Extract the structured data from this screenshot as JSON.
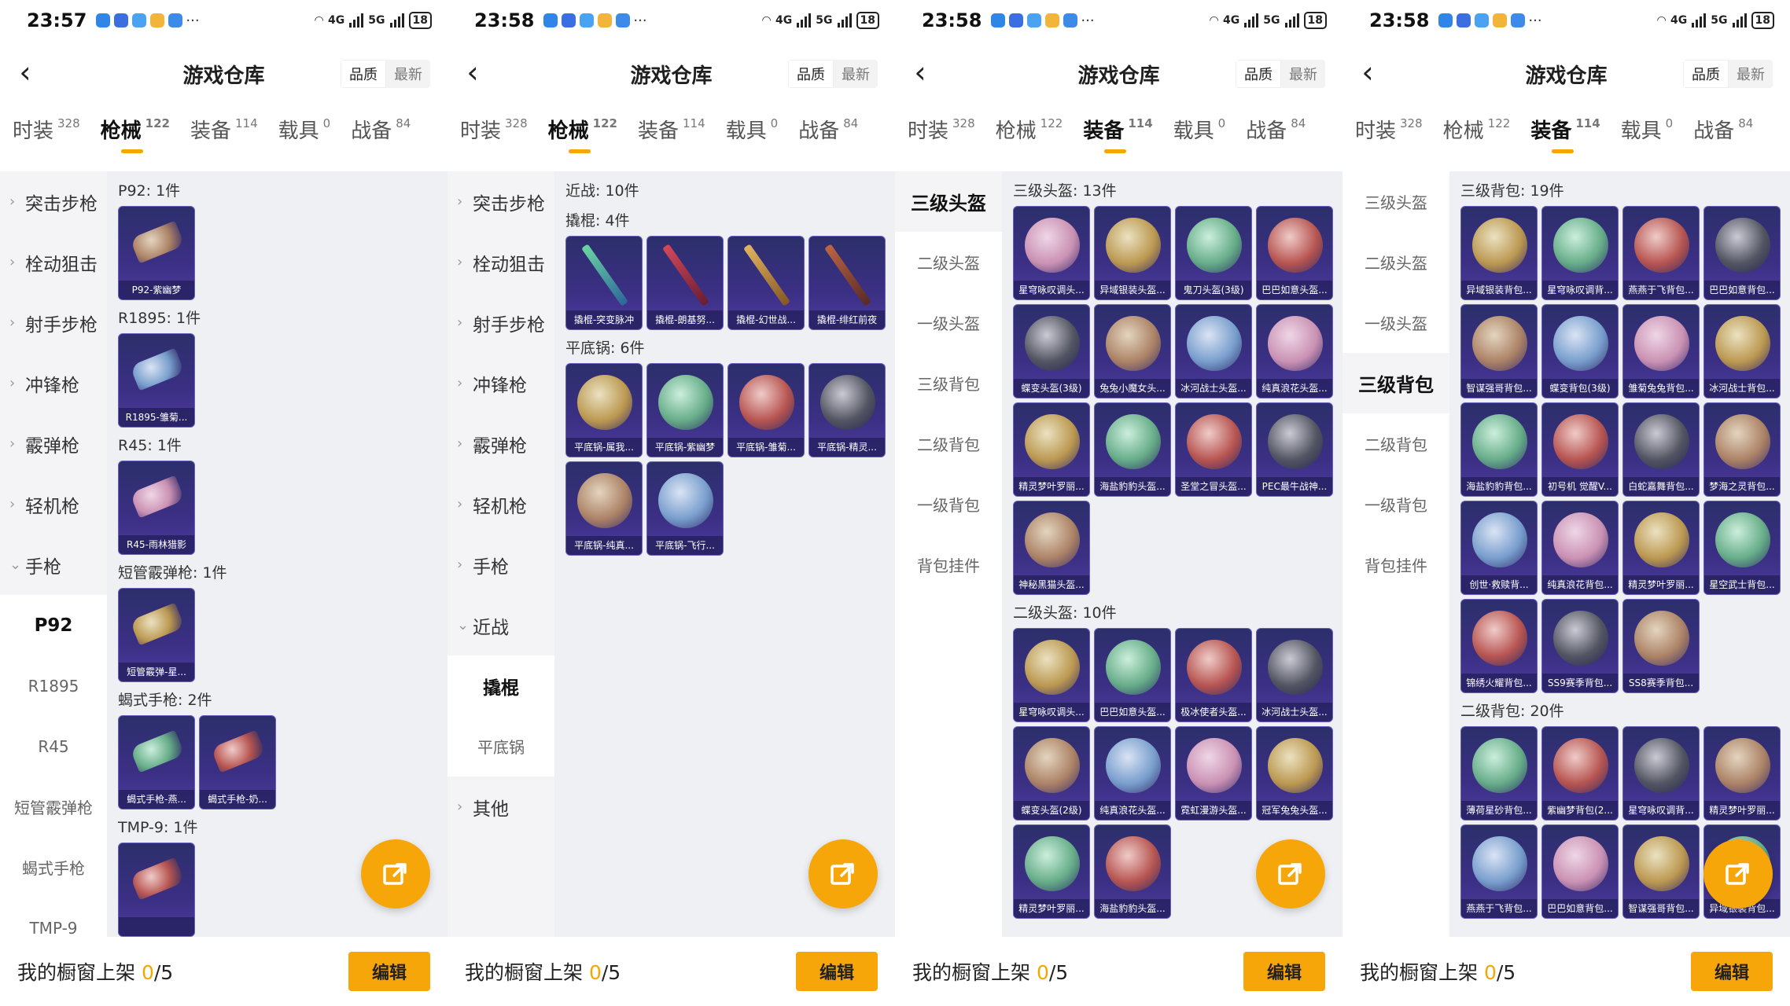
{
  "panels": [
    {
      "status": {
        "time": "23:57",
        "battery": "18",
        "net1": "4G",
        "net2": "5G"
      },
      "header": {
        "title": "游戏仓库",
        "sort": [
          "品质",
          "最新"
        ],
        "back_icon": "chevron-left-icon"
      },
      "tabs": [
        {
          "label": "时装",
          "count": "328"
        },
        {
          "label": "枪械",
          "count": "122"
        },
        {
          "label": "装备",
          "count": "114"
        },
        {
          "label": "载具",
          "count": "0"
        },
        {
          "label": "战备",
          "count": "84"
        }
      ],
      "active_tab": 1,
      "sidebar": [
        {
          "label": "突击步枪",
          "type": "group"
        },
        {
          "label": "栓动狙击",
          "type": "group"
        },
        {
          "label": "射手步枪",
          "type": "group"
        },
        {
          "label": "冲锋枪",
          "type": "group"
        },
        {
          "label": "霰弹枪",
          "type": "group"
        },
        {
          "label": "轻机枪",
          "type": "group"
        },
        {
          "label": "手枪",
          "type": "group-open"
        },
        {
          "label": "P92",
          "type": "sub-on"
        },
        {
          "label": "R1895",
          "type": "sub"
        },
        {
          "label": "R45",
          "type": "sub"
        },
        {
          "label": "短管霰弹枪",
          "type": "sub"
        },
        {
          "label": "蝎式手枪",
          "type": "sub"
        },
        {
          "label": "TMP-9",
          "type": "sub"
        }
      ],
      "sections": [
        {
          "title": "P92: 1件",
          "items": [
            "P92-紫幽梦"
          ]
        },
        {
          "title": "R1895: 1件",
          "items": [
            "R1895-雏菊..."
          ]
        },
        {
          "title": "R45: 1件",
          "items": [
            "R45-雨林猎影"
          ]
        },
        {
          "title": "短管霰弹枪: 1件",
          "items": [
            "短管霰弹-星..."
          ]
        },
        {
          "title": "蝎式手枪: 2件",
          "items": [
            "蝎式手枪-燕...",
            "蝎式手枪-奶..."
          ]
        },
        {
          "title": "TMP-9: 1件",
          "items": [
            ""
          ]
        }
      ],
      "bottom": {
        "shelf_label": "我的橱窗上架",
        "count": "0",
        "total": "/5",
        "edit_label": "编辑"
      }
    },
    {
      "status": {
        "time": "23:58",
        "battery": "18",
        "net1": "4G",
        "net2": "5G"
      },
      "header": {
        "title": "游戏仓库",
        "sort": [
          "品质",
          "最新"
        ],
        "back_icon": "chevron-left-icon"
      },
      "tabs": [
        {
          "label": "时装",
          "count": "328"
        },
        {
          "label": "枪械",
          "count": "122"
        },
        {
          "label": "装备",
          "count": "114"
        },
        {
          "label": "载具",
          "count": "0"
        },
        {
          "label": "战备",
          "count": "84"
        }
      ],
      "active_tab": 1,
      "sidebar": [
        {
          "label": "突击步枪",
          "type": "group"
        },
        {
          "label": "栓动狙击",
          "type": "group"
        },
        {
          "label": "射手步枪",
          "type": "group"
        },
        {
          "label": "冲锋枪",
          "type": "group"
        },
        {
          "label": "霰弹枪",
          "type": "group"
        },
        {
          "label": "轻机枪",
          "type": "group"
        },
        {
          "label": "手枪",
          "type": "group"
        },
        {
          "label": "近战",
          "type": "group-open"
        },
        {
          "label": "撬棍",
          "type": "sub-on"
        },
        {
          "label": "平底锅",
          "type": "sub"
        },
        {
          "label": "其他",
          "type": "group"
        }
      ],
      "sections": [
        {
          "title": "近战: 10件",
          "items": []
        },
        {
          "title": "撬棍: 4件",
          "items": [
            "撬棍-突变脉冲",
            "撬棍-朗基努...",
            "撬棍-幻世战...",
            "撬棍-绯红前夜"
          ]
        },
        {
          "title": "平底锅: 6件",
          "items": [
            "平底锅-属我...",
            "平底锅-紫幽梦",
            "平底锅-雏菊...",
            "平底锅-精灵...",
            "平底锅-纯真...",
            "平底锅-飞行..."
          ]
        }
      ],
      "bottom": {
        "shelf_label": "我的橱窗上架",
        "count": "0",
        "total": "/5",
        "edit_label": "编辑"
      }
    },
    {
      "status": {
        "time": "23:58",
        "battery": "18",
        "net1": "4G",
        "net2": "5G"
      },
      "header": {
        "title": "游戏仓库",
        "sort": [
          "品质",
          "最新"
        ],
        "back_icon": "chevron-left-icon"
      },
      "tabs": [
        {
          "label": "时装",
          "count": "328"
        },
        {
          "label": "枪械",
          "count": "122"
        },
        {
          "label": "装备",
          "count": "114"
        },
        {
          "label": "载具",
          "count": "0"
        },
        {
          "label": "战备",
          "count": "84"
        }
      ],
      "active_tab": 2,
      "sidebar": [
        {
          "label": "三级头盔",
          "type": "flat-on"
        },
        {
          "label": "二级头盔",
          "type": "flat"
        },
        {
          "label": "一级头盔",
          "type": "flat"
        },
        {
          "label": "三级背包",
          "type": "flat"
        },
        {
          "label": "二级背包",
          "type": "flat"
        },
        {
          "label": "一级背包",
          "type": "flat"
        },
        {
          "label": "背包挂件",
          "type": "flat"
        }
      ],
      "sections": [
        {
          "title": "三级头盔: 13件",
          "items": [
            "星穹咏叹调头...",
            "异域银装头盔...",
            "鬼刀头盔(3级)",
            "巴巴如意头盔...",
            "蝶变头盔(3级)",
            "兔兔小魔女头...",
            "冰河战士头盔...",
            "纯真浪花头盔...",
            "精灵梦叶罗丽...",
            "海盐豹豹头盔...",
            "圣堂之冒头盔...",
            "PEC最牛战神...",
            "神秘黑猫头盔..."
          ]
        },
        {
          "title": "二级头盔: 10件",
          "items": [
            "星穹咏叹调头...",
            "巴巴如意头盔...",
            "极冰使者头盔...",
            "冰河战士头盔...",
            "蝶变头盔(2级)",
            "纯真浪花头盔...",
            "霓虹漫游头盔...",
            "冠军兔兔头盔...",
            "精灵梦叶罗丽...",
            "海盐豹豹头盔..."
          ]
        }
      ],
      "bottom": {
        "shelf_label": "我的橱窗上架",
        "count": "0",
        "total": "/5",
        "edit_label": "编辑"
      }
    },
    {
      "status": {
        "time": "23:58",
        "battery": "18",
        "net1": "4G",
        "net2": "5G"
      },
      "header": {
        "title": "游戏仓库",
        "sort": [
          "品质",
          "最新"
        ],
        "back_icon": "chevron-left-icon"
      },
      "tabs": [
        {
          "label": "时装",
          "count": "328"
        },
        {
          "label": "枪械",
          "count": "122"
        },
        {
          "label": "装备",
          "count": "114"
        },
        {
          "label": "载具",
          "count": "0"
        },
        {
          "label": "战备",
          "count": "84"
        }
      ],
      "active_tab": 2,
      "sidebar": [
        {
          "label": "三级头盔",
          "type": "flat"
        },
        {
          "label": "二级头盔",
          "type": "flat"
        },
        {
          "label": "一级头盔",
          "type": "flat"
        },
        {
          "label": "三级背包",
          "type": "flat-on"
        },
        {
          "label": "二级背包",
          "type": "flat"
        },
        {
          "label": "一级背包",
          "type": "flat"
        },
        {
          "label": "背包挂件",
          "type": "flat"
        }
      ],
      "sections": [
        {
          "title": "三级背包: 19件",
          "items": [
            "异域银装背包...",
            "星穹咏叹调背...",
            "燕燕于飞背包...",
            "巴巴如意背包...",
            "智谋强哥背包...",
            "蝶变背包(3级)",
            "雏菊兔兔背包...",
            "冰河战士背包...",
            "海盐豹豹背包...",
            "初号机 觉醒V...",
            "白蛇嘉舞背包...",
            "梦海之灵背包...",
            "创世·救赎背...",
            "纯真浪花背包...",
            "精灵梦叶罗丽...",
            "星空武士背包...",
            "锦绣火耀背包...",
            "SS9赛季背包...",
            "SS8赛季背包..."
          ]
        },
        {
          "title": "二级背包: 20件",
          "items": [
            "薄荷星砂背包...",
            "紫幽梦背包(2...",
            "星穹咏叹调背...",
            "精灵梦叶罗丽...",
            "燕燕于飞背包...",
            "巴巴如意背包...",
            "智谋强哥背包...",
            "异域银装背包..."
          ]
        }
      ],
      "bottom": {
        "shelf_label": "我的橱窗上架",
        "count": "0",
        "total": "/5",
        "edit_label": "编辑"
      }
    }
  ]
}
